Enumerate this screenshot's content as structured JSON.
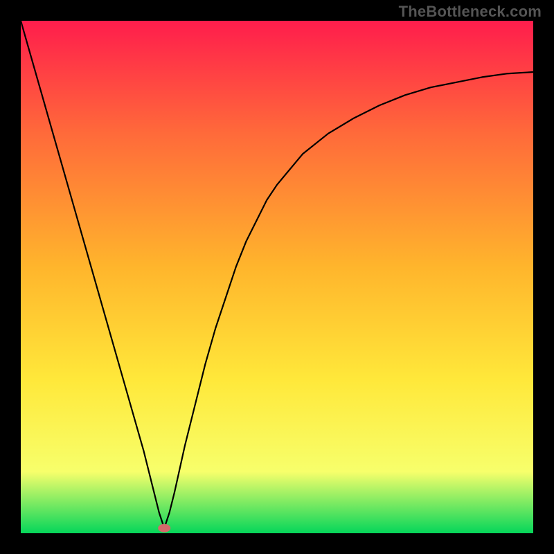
{
  "watermark": "TheBottleneck.com",
  "chart_data": {
    "type": "line",
    "title": "",
    "xlabel": "",
    "ylabel": "",
    "xlim": [
      0,
      100
    ],
    "ylim": [
      0,
      100
    ],
    "grid": false,
    "legend": false,
    "annotations": [],
    "background_gradient": {
      "top_color": "#ff1d4c",
      "mid_top_color": "#ff6a3a",
      "mid_color": "#ffb52c",
      "mid_low_color": "#ffe83a",
      "low_color": "#f7ff6b",
      "bottom_color": "#05d65a"
    },
    "marker": {
      "x": 28,
      "y": 1,
      "color": "#d46a6a"
    },
    "series": [
      {
        "name": "curve",
        "color": "#000000",
        "x": [
          0,
          2,
          4,
          6,
          8,
          10,
          12,
          14,
          16,
          18,
          20,
          22,
          24,
          26,
          27,
          28,
          29,
          30,
          32,
          34,
          36,
          38,
          40,
          42,
          44,
          46,
          48,
          50,
          55,
          60,
          65,
          70,
          75,
          80,
          85,
          90,
          95,
          100
        ],
        "y": [
          100,
          93,
          86,
          79,
          72,
          65,
          58,
          51,
          44,
          37,
          30,
          23,
          16,
          8,
          4,
          1,
          4,
          8,
          17,
          25,
          33,
          40,
          46,
          52,
          57,
          61,
          65,
          68,
          74,
          78,
          81,
          83.5,
          85.5,
          87,
          88,
          89,
          89.7,
          90
        ]
      }
    ]
  }
}
